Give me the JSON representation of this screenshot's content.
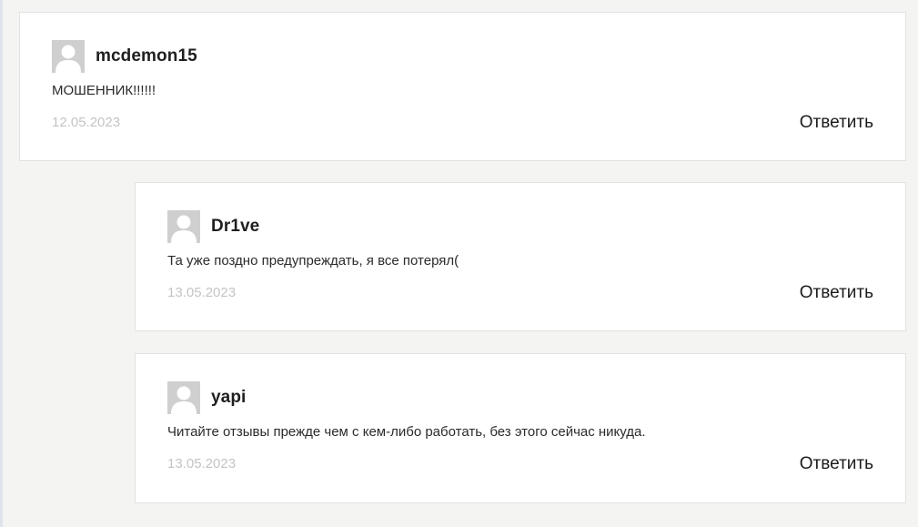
{
  "comments": [
    {
      "author": "mcdemon15",
      "text": "МОШЕННИК!!!!!!",
      "date": "12.05.2023",
      "reply_label": "Ответить"
    },
    {
      "author": "Dr1ve",
      "text": "Та уже поздно предупреждать, я все потерял(",
      "date": "13.05.2023",
      "reply_label": "Ответить"
    },
    {
      "author": "yapi",
      "text": "Читайте отзывы прежде чем с кем-либо работать, без этого сейчас никуда.",
      "date": "13.05.2023",
      "reply_label": "Ответить"
    }
  ],
  "icons": {
    "avatar": "user-silhouette-icon"
  },
  "colors": {
    "page_background": "#f4f4f2",
    "card_background": "#ffffff",
    "card_border": "#e2e2e2",
    "date_text": "#c4c4c4",
    "avatar_background": "#cfcfcf"
  }
}
